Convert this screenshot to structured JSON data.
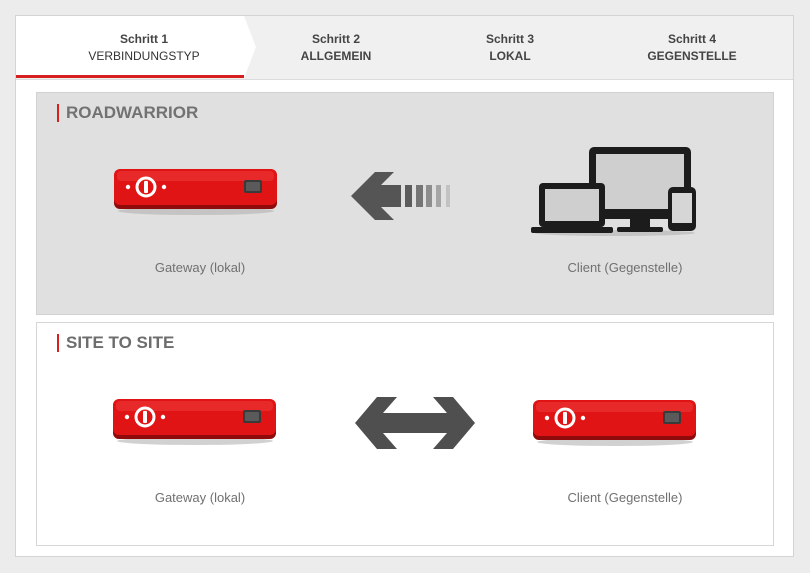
{
  "steps": [
    {
      "number": "Schritt 1",
      "name": "VERBINDUNGSTYP",
      "active": true
    },
    {
      "number": "Schritt 2",
      "name": "ALLGEMEIN",
      "active": false
    },
    {
      "number": "Schritt 3",
      "name": "LOKAL",
      "active": false
    },
    {
      "number": "Schritt 4",
      "name": "GEGENSTELLE",
      "active": false
    }
  ],
  "roadwarrior": {
    "title": "ROADWARRIOR",
    "left_caption": "Gateway (lokal)",
    "right_caption": "Client (Gegenstelle)"
  },
  "site_to_site": {
    "title": "SITE TO SITE",
    "left_caption": "Gateway (lokal)",
    "right_caption": "Client (Gegenstelle)"
  },
  "colors": {
    "accent": "#d62020",
    "device_red": "#e01414",
    "arrow_gray": "#555555"
  }
}
